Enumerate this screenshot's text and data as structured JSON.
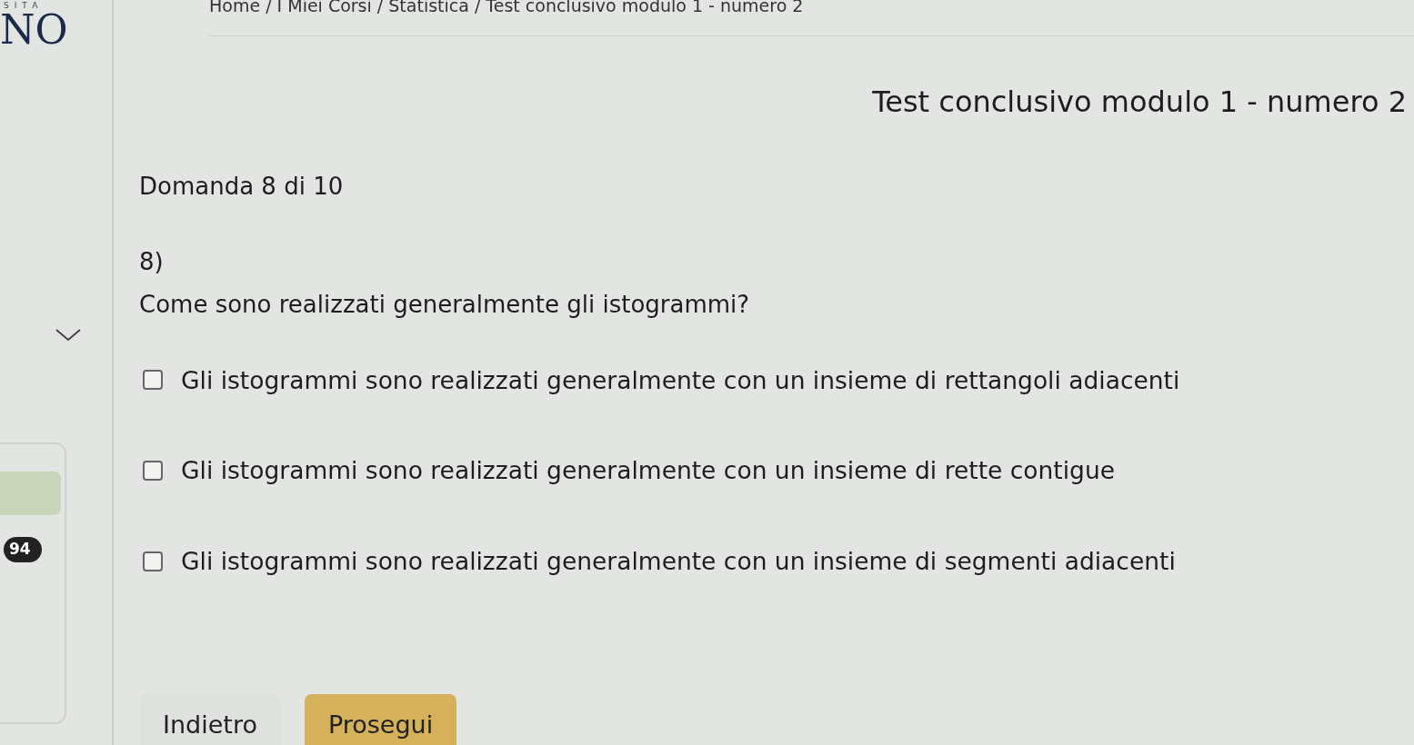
{
  "logo": {
    "subtitle": "SITA",
    "text": "NO"
  },
  "breadcrumb": "Home / I Miei Corsi / Statistica / Test conclusivo modulo 1 - numero 2",
  "sidebar": {
    "expanded": true,
    "badge": "94"
  },
  "title": "Test conclusivo modulo 1 - numero 2",
  "progress": "Domanda 8 di 10",
  "question": {
    "number": "8)",
    "text": "Come sono realizzati generalmente gli istogrammi?"
  },
  "options": [
    {
      "label": "Gli istogrammi sono realizzati generalmente con un insieme di rettangoli adiacenti",
      "selected": false
    },
    {
      "label": "Gli istogrammi sono realizzati generalmente con un insieme di rette contigue",
      "selected": false
    },
    {
      "label": "Gli istogrammi sono realizzati generalmente con un insieme di segmenti adiacenti",
      "selected": false
    }
  ],
  "buttons": [
    {
      "label": "Indietro",
      "kind": "secondary"
    },
    {
      "label": "Prosegui",
      "kind": "primary"
    }
  ]
}
